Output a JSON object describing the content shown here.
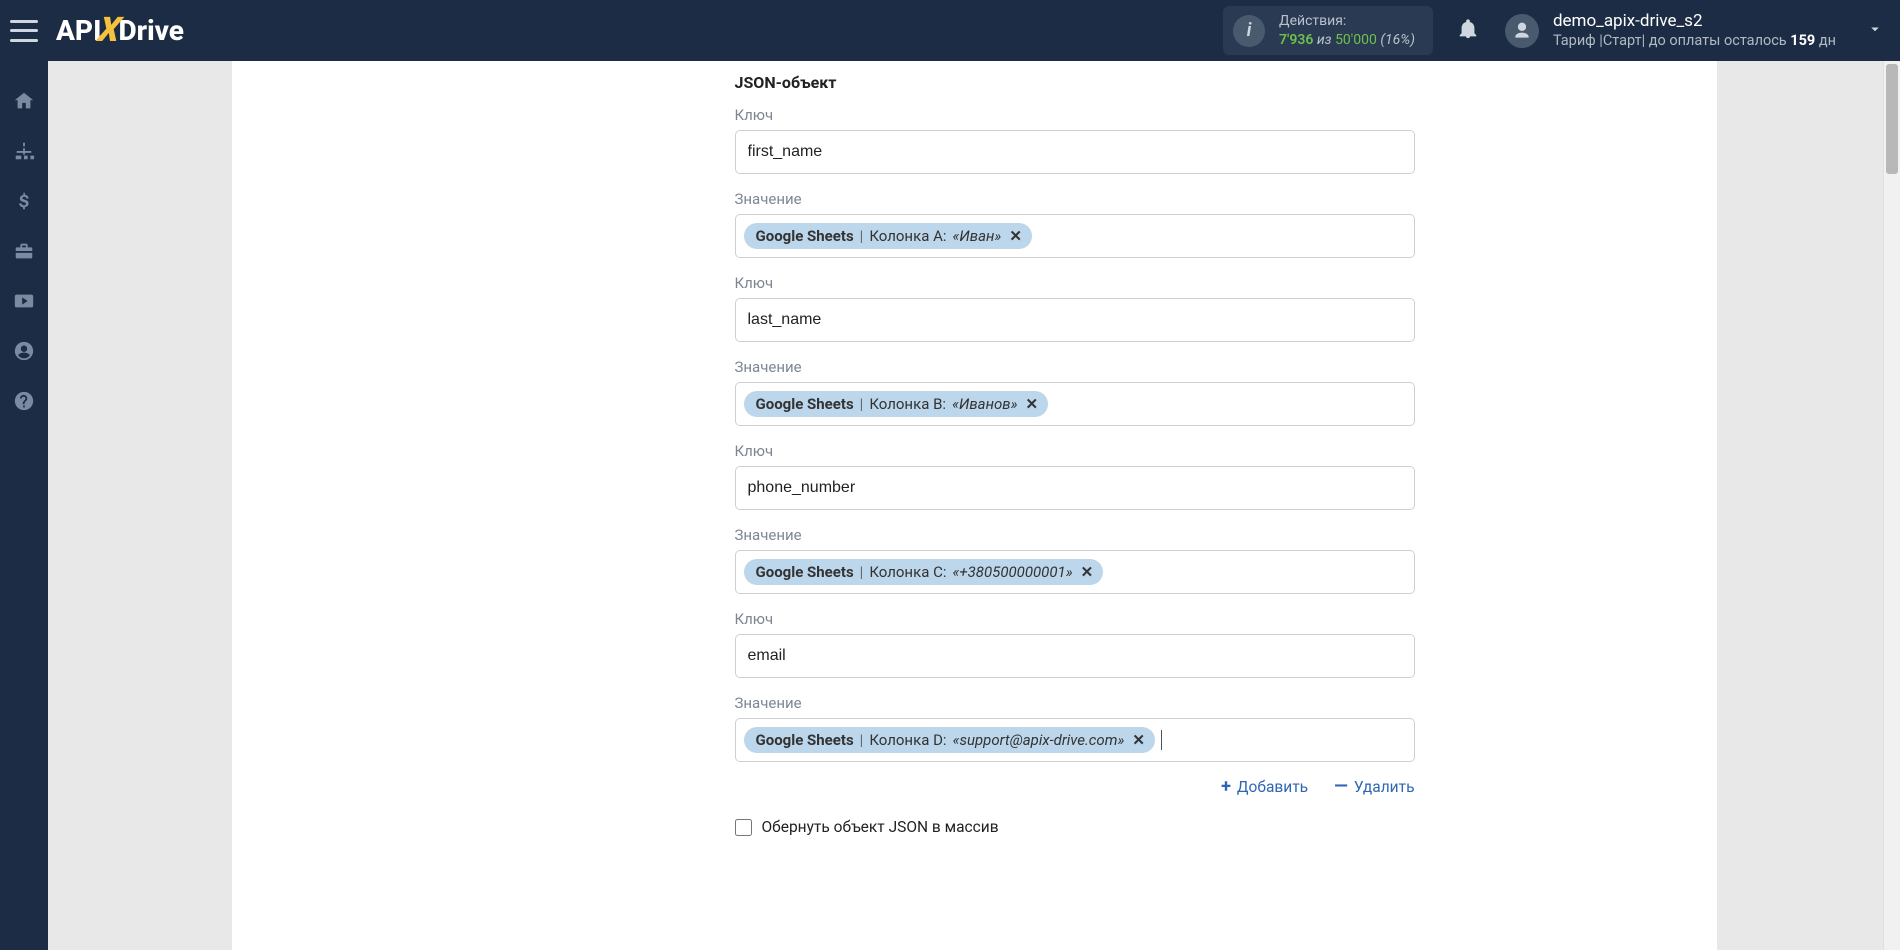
{
  "header": {
    "logo_api": "API",
    "logo_x": "X",
    "logo_drive": "Drive",
    "actions_label": "Действия:",
    "actions_used": "7'936",
    "actions_of": "из",
    "actions_limit": "50'000",
    "actions_pct": "(16%)",
    "username": "demo_apix-drive_s2",
    "tariff_prefix": "Тариф |Старт| до оплаты осталось",
    "tariff_days": "159",
    "tariff_days_suffix": "дн"
  },
  "form": {
    "section_title": "JSON-объект",
    "key_label": "Ключ",
    "value_label": "Значение",
    "tag_source": "Google Sheets",
    "pairs": [
      {
        "key": "first_name",
        "column": "Колонка A:",
        "sample": "«Иван»"
      },
      {
        "key": "last_name",
        "column": "Колонка B:",
        "sample": "«Иванов»"
      },
      {
        "key": "phone_number",
        "column": "Колонка C:",
        "sample": "«+380500000001»"
      },
      {
        "key": "email",
        "column": "Колонка D:",
        "sample": "«support@apix-drive.com»"
      }
    ],
    "add_label": "Добавить",
    "remove_label": "Удалить",
    "wrap_checkbox_label": "Обернуть объект JSON в массив"
  }
}
